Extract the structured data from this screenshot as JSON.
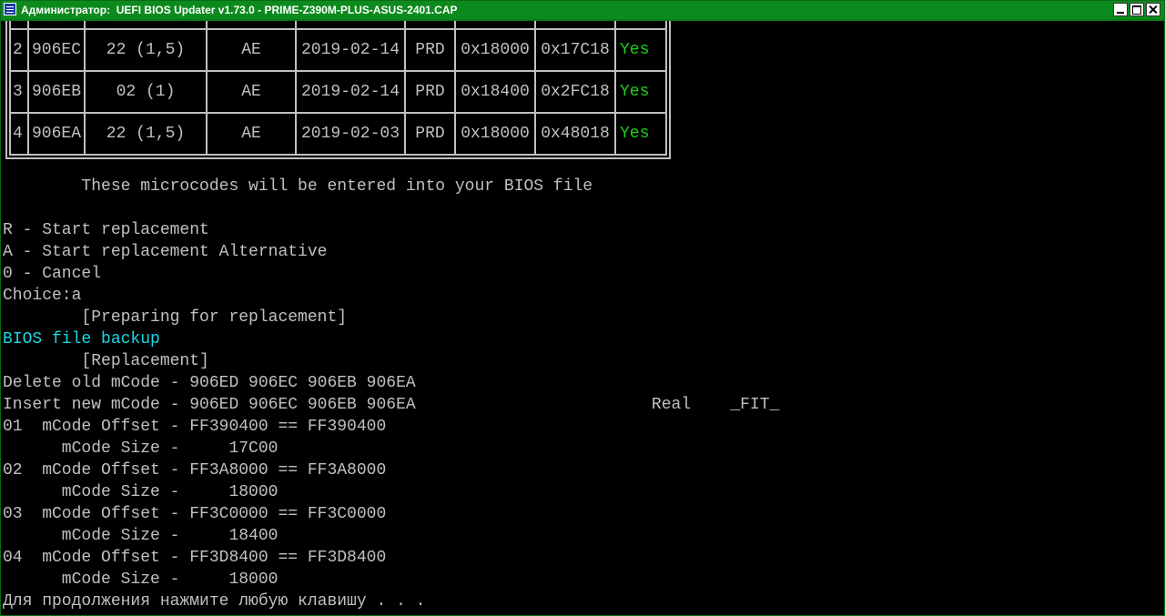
{
  "window": {
    "title": "Администратор:  UEFI BIOS Updater v1.73.0 - PRIME-Z390M-PLUS-ASUS-2401.CAP"
  },
  "microcode_table": {
    "rows": [
      {
        "num": "2",
        "cpuid": "906EC",
        "platform": "22 (1,5)",
        "rev": "AE",
        "date": "2019-02-14",
        "type": "PRD",
        "offset": "0x18000",
        "size": "0x17C18",
        "status": "Yes"
      },
      {
        "num": "3",
        "cpuid": "906EB",
        "platform": "02 (1)",
        "rev": "AE",
        "date": "2019-02-14",
        "type": "PRD",
        "offset": "0x18400",
        "size": "0x2FC18",
        "status": "Yes"
      },
      {
        "num": "4",
        "cpuid": "906EA",
        "platform": "22 (1,5)",
        "rev": "AE",
        "date": "2019-02-03",
        "type": "PRD",
        "offset": "0x18000",
        "size": "0x48018",
        "status": "Yes"
      }
    ]
  },
  "console": {
    "lines": [
      "        These microcodes will be entered into your BIOS file",
      "",
      "R - Start replacement",
      "A - Start replacement Alternative",
      "0 - Cancel",
      "Choice:a",
      "        [Preparing for replacement]",
      "BIOS file backup",
      "        [Replacement]",
      "Delete old mCode - 906ED 906EC 906EB 906EA",
      "Insert new mCode - 906ED 906EC 906EB 906EA                        Real    _FIT_",
      "01  mCode Offset - FF390400 == FF390400",
      "      mCode Size -     17C00",
      "02  mCode Offset - FF3A8000 == FF3A8000",
      "      mCode Size -     18000",
      "03  mCode Offset - FF3C0000 == FF3C0000",
      "      mCode Size -     18400",
      "04  mCode Offset - FF3D8400 == FF3D8400",
      "      mCode Size -     18000",
      "Для продолжения нажмите любую клавишу . . ."
    ],
    "highlight_color": "#1cd8e8",
    "ok_color": "#1cd11c",
    "text_color": "#c0c0c0",
    "background": "#000000"
  }
}
